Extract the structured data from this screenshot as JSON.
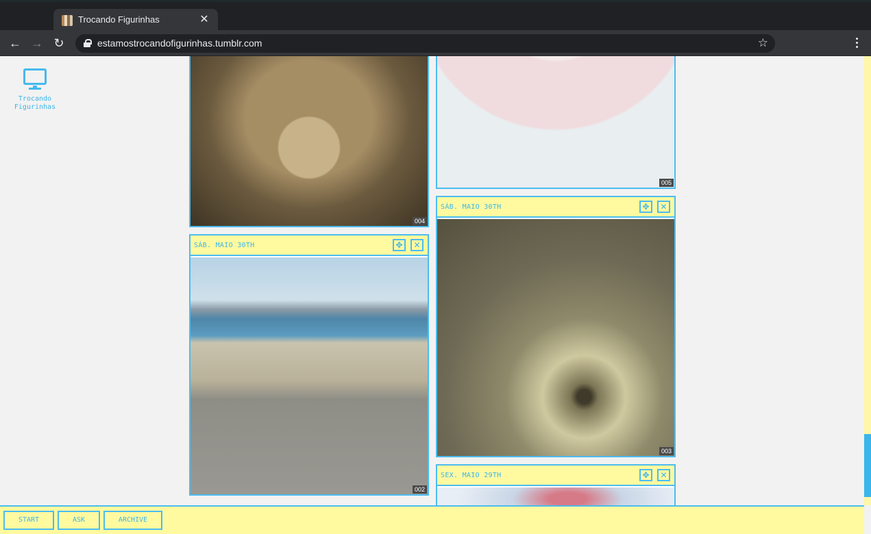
{
  "browser": {
    "tab_title": "Trocando Figurinhas",
    "url": "estamostrocandofigurinhas.tumblr.com",
    "icons": {
      "back": "arrow-left-icon",
      "forward": "arrow-right-icon",
      "reload": "reload-icon",
      "secure": "lock-icon",
      "bookmark": "star-icon",
      "menu": "kebab-menu-icon",
      "close": "close-icon"
    }
  },
  "desktop": {
    "icon_label": "Trocando Figurinhas",
    "icon": "monitor-icon"
  },
  "posts": [
    {
      "number": "004",
      "date": "",
      "image": "snail-shell-sculpture"
    },
    {
      "number": "005",
      "date": "",
      "image": "painted-shell-fan"
    },
    {
      "number": "002",
      "date": "SÁB. MAIO 30TH",
      "image": "sheep-on-road"
    },
    {
      "number": "003",
      "date": "SÁB. MAIO 30TH",
      "image": "radial-burst-drawing"
    },
    {
      "number": "",
      "date": "SEX. MAIO 29TH",
      "image": "blurred-photo"
    }
  ],
  "post_controls": {
    "move_icon": "move-icon",
    "close_icon": "close-icon"
  },
  "nav": {
    "start": "START",
    "ask": "ASK",
    "archive": "ARCHIVE"
  },
  "colors": {
    "accent": "#4bbcf0",
    "header_bg": "#fff9a0",
    "page_bg": "#f2f2f2"
  }
}
